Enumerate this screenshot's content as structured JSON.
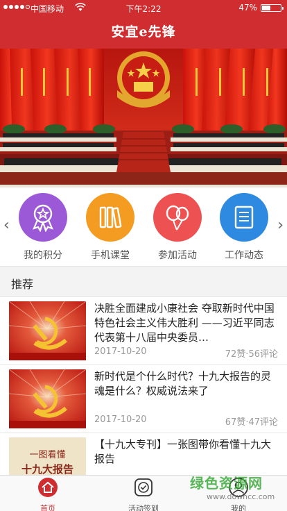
{
  "status": {
    "carrier": "中国移动",
    "time": "下午2:22",
    "battery": "47%",
    "battery_level": 0.47
  },
  "header": {
    "title": "安宜e先锋"
  },
  "quick_nav": {
    "items": [
      {
        "label": "我的积分",
        "icon": "award-ribbon-icon",
        "color": "#9b59d8"
      },
      {
        "label": "手机课堂",
        "icon": "books-icon",
        "color": "#f39c21"
      },
      {
        "label": "参加活动",
        "icon": "balloons-icon",
        "color": "#ee5151"
      },
      {
        "label": "工作动态",
        "icon": "document-icon",
        "color": "#2e8ae0"
      }
    ]
  },
  "recommend": {
    "heading": "推荐",
    "items": [
      {
        "title": "决胜全面建成小康社会 夺取新时代中国特色社会主义伟大胜利 ——习近平同志代表第十八届中央委员…",
        "date": "2017-10-20",
        "meta": "72赞·56评论"
      },
      {
        "title": "新时代是个什么时代？十九大报告的灵魂是什么？权威说法来了",
        "date": "2017-10-20",
        "meta": "67赞·47评论"
      },
      {
        "title": "【十九大专刊】一张图带你看懂十九大报告",
        "date": "",
        "meta": "",
        "thumb_text": [
          "一图看懂",
          "十九大报告"
        ]
      }
    ]
  },
  "tabs": [
    {
      "label": "首页",
      "icon": "home-icon",
      "active": true
    },
    {
      "label": "活动签到",
      "icon": "check-in-icon",
      "active": false
    },
    {
      "label": "我的",
      "icon": "user-icon",
      "active": false
    }
  ],
  "watermark": {
    "text": "绿色资源网",
    "url": "www.downcc.com"
  },
  "colors": {
    "brand_red": "#cf2d30"
  }
}
